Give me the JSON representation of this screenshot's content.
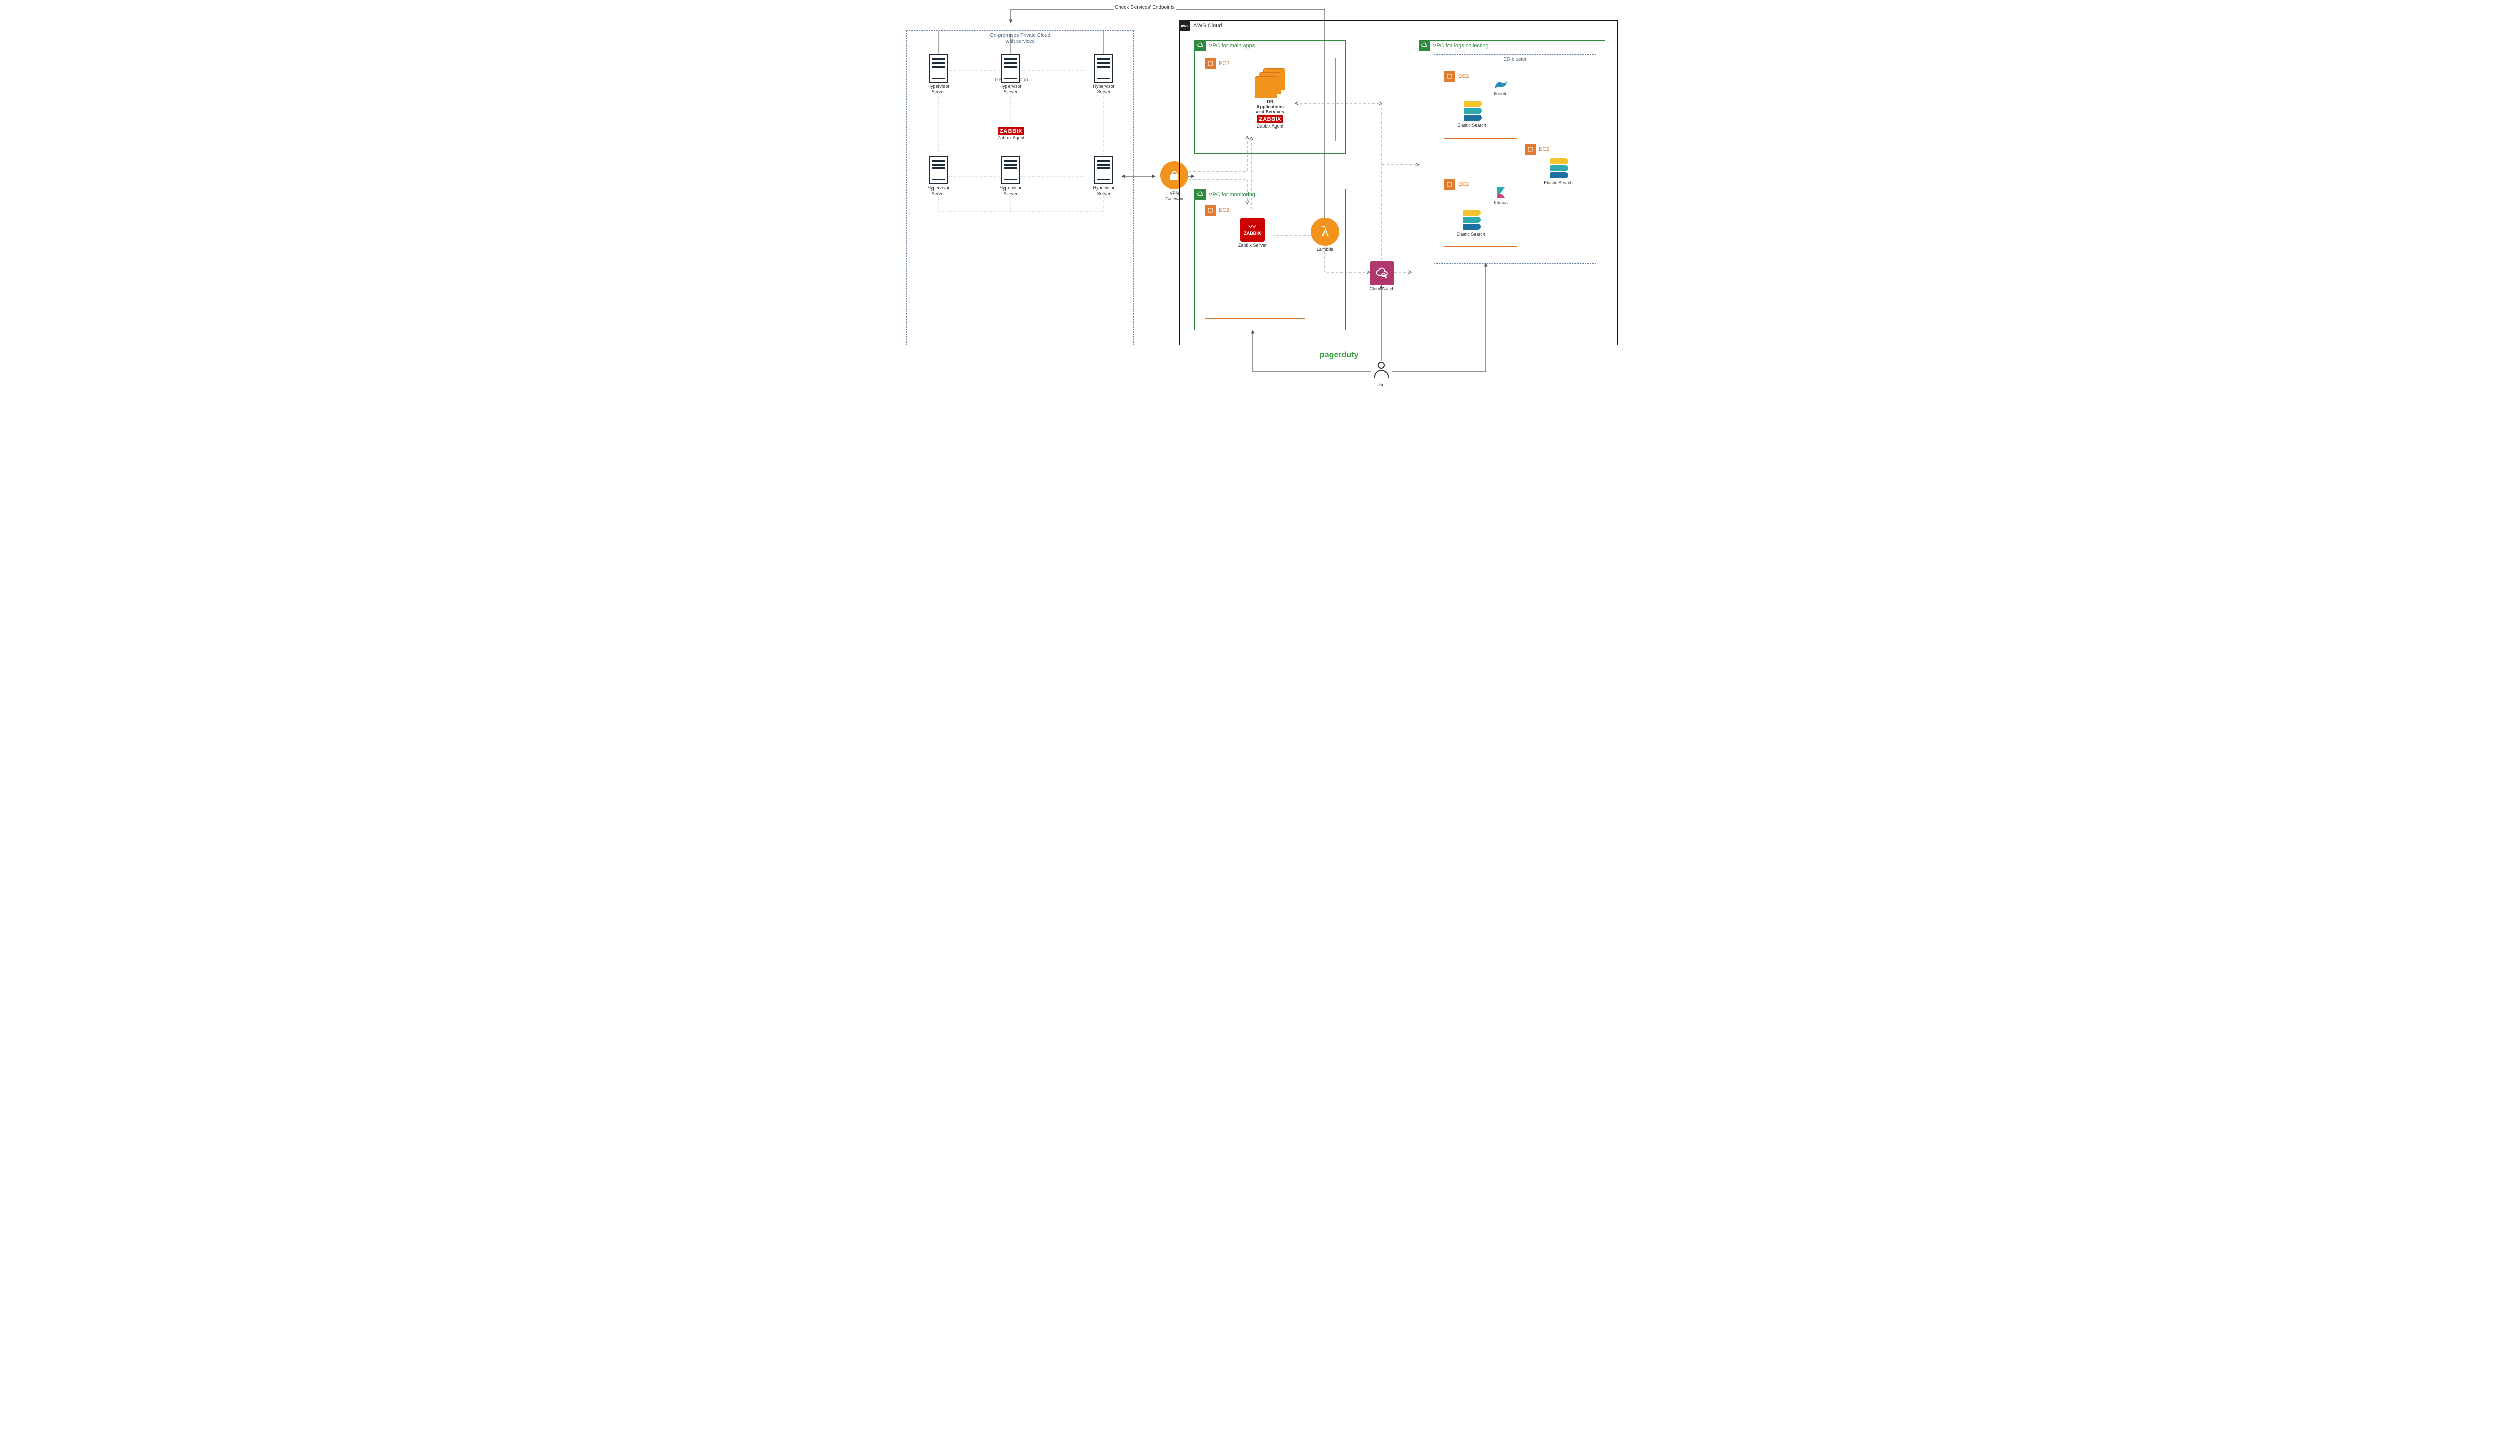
{
  "edge_labels": {
    "check_endpoints": "Check Services' Endpoints",
    "generic_group": "Generic Group"
  },
  "onprem": {
    "title": "On-premises Private Cloud\nwith services",
    "server_label": "Hypervisor\nServer",
    "zabbix_logo": "ZABBIX",
    "zabbix_agent": "Zabbix Agent"
  },
  "vpn": {
    "label": "VPN\nGateway"
  },
  "aws": {
    "title": "AWS Cloud",
    "badge": "aws",
    "vpc_main": {
      "title": "VPC for main apps"
    },
    "vpc_mon": {
      "title": "VPC for monitoring"
    },
    "vpc_logs": {
      "title": "VPC for logs collecting"
    },
    "ec2": "EC2",
    "es_cluster_title": "ES cluster",
    "dr_apps": "DR\nApplications\nand Services",
    "zabbix_logo": "ZABBIX",
    "zabbix_agent": "Zabbix Agent",
    "zabbix_server": "Zabbix Server",
    "lambda": "Lambda",
    "cloudwatch": "CloudWatch",
    "fluentd": "fluentd",
    "kibana": "Kibana",
    "elastic_search": "Elastic Search"
  },
  "pagerduty": "pagerduty",
  "user": "User"
}
